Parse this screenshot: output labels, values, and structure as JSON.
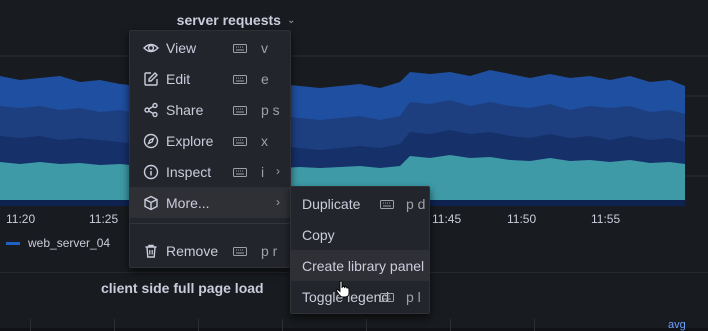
{
  "panel": {
    "title": "server requests",
    "x_ticks": [
      "11:20",
      "11:25",
      "11:45",
      "11:50",
      "11:55"
    ],
    "legend_item": "web_server_04",
    "colors": {
      "band1": "#1f4fa0",
      "band2": "#1d3f80",
      "band3": "#16306a",
      "band4": "#0e2250",
      "teal": "#3d9aa6",
      "legend": "#1f60c4"
    }
  },
  "menu": {
    "items": [
      {
        "label": "View",
        "shortcut": "v",
        "icon": "eye-icon"
      },
      {
        "label": "Edit",
        "shortcut": "e",
        "icon": "edit-icon"
      },
      {
        "label": "Share",
        "shortcut": "p s",
        "icon": "share-icon"
      },
      {
        "label": "Explore",
        "shortcut": "x",
        "icon": "compass-icon"
      },
      {
        "label": "Inspect",
        "shortcut": "i",
        "icon": "info-icon"
      },
      {
        "label": "More...",
        "icon": "cube-icon"
      },
      {
        "label": "Remove",
        "shortcut": "p r",
        "icon": "trash-icon"
      }
    ]
  },
  "submenu": {
    "items": [
      {
        "label": "Duplicate",
        "shortcut": "p d"
      },
      {
        "label": "Copy"
      },
      {
        "label": "Create library panel"
      },
      {
        "label": "Toggle legend",
        "shortcut": "p l"
      }
    ]
  },
  "bottom_panel": {
    "title": "client side full page load",
    "legend_stat": "avg"
  }
}
